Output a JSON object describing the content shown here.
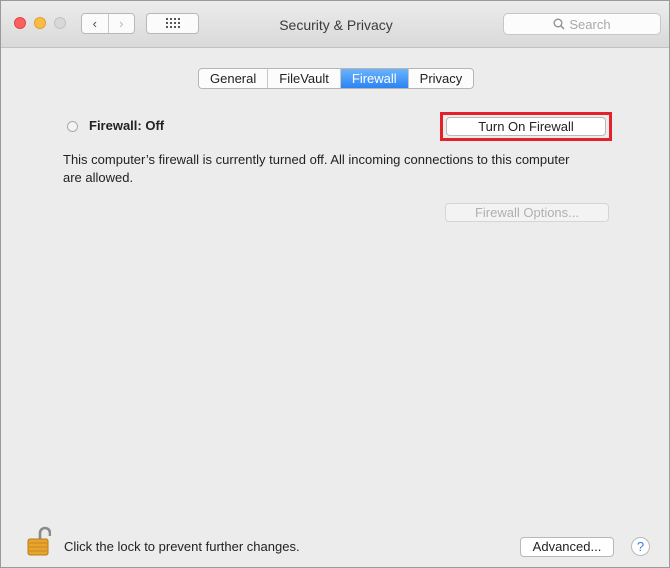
{
  "window": {
    "title": "Security & Privacy",
    "back_glyph": "‹",
    "forward_glyph": "›"
  },
  "search": {
    "placeholder": "Search",
    "icon": "magnifier-icon"
  },
  "tabs": [
    {
      "label": "General",
      "active": false
    },
    {
      "label": "FileVault",
      "active": false
    },
    {
      "label": "Firewall",
      "active": true
    },
    {
      "label": "Privacy",
      "active": false
    }
  ],
  "firewall": {
    "status_label": "Firewall: Off",
    "turn_on_label": "Turn On Firewall",
    "description": "This computer’s firewall is currently turned off. All incoming connections to this computer are allowed.",
    "options_label": "Firewall Options..."
  },
  "footer": {
    "lock_text": "Click the lock to prevent further changes.",
    "advanced_label": "Advanced...",
    "help_label": "?"
  },
  "colors": {
    "accent": "#2a83f6",
    "highlight_box": "#e3212b",
    "lock_gold": "#e8a52d"
  }
}
